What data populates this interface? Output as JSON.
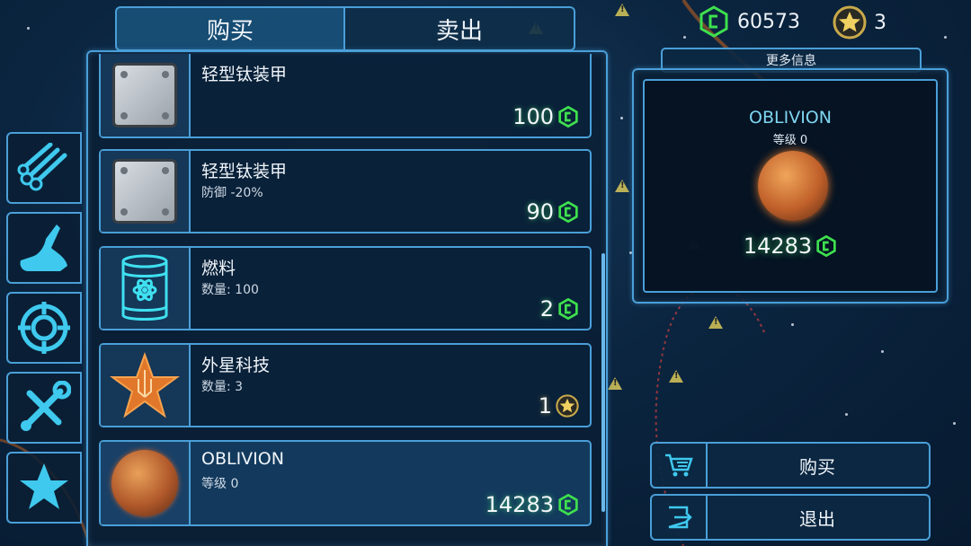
{
  "tabs": {
    "buy": "购买",
    "sell": "卖出"
  },
  "resources": {
    "credits": "60573",
    "stars": "3"
  },
  "sidebar": [
    {
      "icon": "pipes-icon"
    },
    {
      "icon": "claw-icon"
    },
    {
      "icon": "target-icon"
    },
    {
      "icon": "tools-icon"
    },
    {
      "icon": "star-icon"
    }
  ],
  "items": [
    {
      "name": "轻型钛装甲",
      "sub": "",
      "price": "100",
      "currency": "credit"
    },
    {
      "name": "轻型钛装甲",
      "sub": "防御 -20%",
      "price": "90",
      "currency": "credit"
    },
    {
      "name": "燃料",
      "sub": "数量: 100",
      "price": "2",
      "currency": "credit"
    },
    {
      "name": "外星科技",
      "sub": "数量: 3",
      "price": "1",
      "currency": "star"
    },
    {
      "name": "OBLIVION",
      "sub": "等级 0",
      "price": "14283",
      "currency": "credit"
    }
  ],
  "info": {
    "header": "更多信息",
    "name": "OBLIVION",
    "level": "等级 0",
    "price": "14283"
  },
  "actions": {
    "buy": "购买",
    "exit": "退出"
  },
  "colors": {
    "accent": "#4a9fd8",
    "credit": "#3ee04e",
    "star": "#e8c24a"
  }
}
